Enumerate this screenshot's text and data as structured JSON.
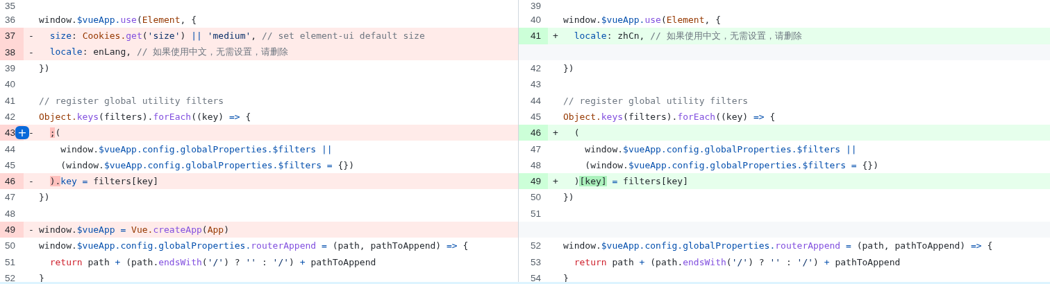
{
  "diff": {
    "left": {
      "lines": [
        {
          "number": "35",
          "kind": "context"
        },
        {
          "number": "36",
          "kind": "context",
          "tokens": [
            {
              "text": "window.",
              "kind": "plain"
            },
            {
              "text": "$vueApp.",
              "kind": "property"
            },
            {
              "text": "use",
              "kind": "function"
            },
            {
              "text": "(",
              "kind": "plain"
            },
            {
              "text": "Element",
              "kind": "class"
            },
            {
              "text": ", {",
              "kind": "plain"
            }
          ]
        },
        {
          "number": "37",
          "kind": "deletion",
          "marker": "-",
          "tokens": [
            {
              "text": "  size",
              "kind": "property"
            },
            {
              "text": ": ",
              "kind": "plain"
            },
            {
              "text": "Cookies.",
              "kind": "class"
            },
            {
              "text": "get",
              "kind": "function"
            },
            {
              "text": "(",
              "kind": "plain"
            },
            {
              "text": "'size'",
              "kind": "string"
            },
            {
              "text": ") ",
              "kind": "plain"
            },
            {
              "text": "|| ",
              "kind": "property"
            },
            {
              "text": "'medium'",
              "kind": "string"
            },
            {
              "text": ", ",
              "kind": "plain"
            },
            {
              "text": "// set element-ui default size",
              "kind": "comment"
            }
          ]
        },
        {
          "number": "38",
          "kind": "deletion",
          "marker": "-",
          "tokens": [
            {
              "text": "  locale",
              "kind": "property"
            },
            {
              "text": ": enLang, ",
              "kind": "plain"
            },
            {
              "text": "// 如果使用中文，无需设置，请删除",
              "kind": "comment"
            }
          ]
        },
        {
          "number": "39",
          "kind": "context",
          "tokens": [
            {
              "text": "})",
              "kind": "plain"
            }
          ]
        },
        {
          "number": "40",
          "kind": "context"
        },
        {
          "number": "41",
          "kind": "context",
          "tokens": [
            {
              "text": "// register global utility filters",
              "kind": "comment"
            }
          ]
        },
        {
          "number": "42",
          "kind": "context",
          "tokens": [
            {
              "text": "Object.",
              "kind": "class"
            },
            {
              "text": "keys",
              "kind": "function"
            },
            {
              "text": "(filters).",
              "kind": "plain"
            },
            {
              "text": "forEach",
              "kind": "function"
            },
            {
              "text": "((key) ",
              "kind": "plain"
            },
            {
              "text": "=>",
              "kind": "property"
            },
            {
              "text": " {",
              "kind": "plain"
            }
          ]
        },
        {
          "number": "43",
          "kind": "deletion",
          "marker": "-",
          "comment_button": "+",
          "tokens": [
            {
              "text": "  ;",
              "kind": "plain",
              "emphasized": true
            },
            {
              "text": "(",
              "kind": "plain"
            }
          ]
        },
        {
          "number": "44",
          "kind": "context",
          "tokens": [
            {
              "text": "    window.",
              "kind": "plain"
            },
            {
              "text": "$vueApp.config.globalProperties.$filters ||",
              "kind": "property"
            }
          ]
        },
        {
          "number": "45",
          "kind": "context",
          "tokens": [
            {
              "text": "    (window.",
              "kind": "plain"
            },
            {
              "text": "$vueApp.config.globalProperties.$filters =",
              "kind": "property"
            },
            {
              "text": " {})",
              "kind": "plain"
            }
          ]
        },
        {
          "number": "46",
          "kind": "deletion",
          "marker": "-",
          "tokens": [
            {
              "text": "  ).",
              "kind": "plain",
              "emphasized": true
            },
            {
              "text": "key =",
              "kind": "property"
            },
            {
              "text": " filters[key]",
              "kind": "plain"
            }
          ]
        },
        {
          "number": "47",
          "kind": "context",
          "tokens": [
            {
              "text": "})",
              "kind": "plain"
            }
          ]
        },
        {
          "number": "48",
          "kind": "context"
        },
        {
          "number": "49",
          "kind": "deletion",
          "marker": "-",
          "tokens": [
            {
              "text": "window.",
              "kind": "plain"
            },
            {
              "text": "$vueApp =",
              "kind": "property"
            },
            {
              "text": " Vue.",
              "kind": "class"
            },
            {
              "text": "createApp",
              "kind": "function"
            },
            {
              "text": "(",
              "kind": "plain"
            },
            {
              "text": "App",
              "kind": "class"
            },
            {
              "text": ")",
              "kind": "plain"
            }
          ]
        },
        {
          "number": "50",
          "kind": "context",
          "tokens": [
            {
              "text": "window.",
              "kind": "plain"
            },
            {
              "text": "$vueApp.config.globalProperties.",
              "kind": "property"
            },
            {
              "text": "routerAppend",
              "kind": "function"
            },
            {
              "text": " =",
              "kind": "property"
            },
            {
              "text": " (path, pathToAppend) ",
              "kind": "plain"
            },
            {
              "text": "=>",
              "kind": "property"
            },
            {
              "text": " {",
              "kind": "plain"
            }
          ]
        },
        {
          "number": "51",
          "kind": "context",
          "tokens": [
            {
              "text": "  return",
              "kind": "keyword"
            },
            {
              "text": " path ",
              "kind": "plain"
            },
            {
              "text": "+",
              "kind": "property"
            },
            {
              "text": " (path.",
              "kind": "plain"
            },
            {
              "text": "endsWith",
              "kind": "function"
            },
            {
              "text": "(",
              "kind": "plain"
            },
            {
              "text": "'/'",
              "kind": "string"
            },
            {
              "text": ") ? ",
              "kind": "plain"
            },
            {
              "text": "''",
              "kind": "string"
            },
            {
              "text": " : ",
              "kind": "plain"
            },
            {
              "text": "'/'",
              "kind": "string"
            },
            {
              "text": ") ",
              "kind": "plain"
            },
            {
              "text": "+",
              "kind": "property"
            },
            {
              "text": " pathToAppend",
              "kind": "plain"
            }
          ]
        },
        {
          "number": "52",
          "kind": "context",
          "tokens": [
            {
              "text": "}",
              "kind": "plain"
            }
          ]
        }
      ]
    },
    "right": {
      "lines": [
        {
          "number": "39",
          "kind": "context"
        },
        {
          "number": "40",
          "kind": "context",
          "tokens": [
            {
              "text": "window.",
              "kind": "plain"
            },
            {
              "text": "$vueApp.",
              "kind": "property"
            },
            {
              "text": "use",
              "kind": "function"
            },
            {
              "text": "(",
              "kind": "plain"
            },
            {
              "text": "Element",
              "kind": "class"
            },
            {
              "text": ", {",
              "kind": "plain"
            }
          ]
        },
        {
          "number": "41",
          "kind": "addition",
          "marker": "+",
          "tokens": [
            {
              "text": "  locale",
              "kind": "property"
            },
            {
              "text": ": zhCn, ",
              "kind": "plain"
            },
            {
              "text": "// 如果使用中文，无需设置，请删除",
              "kind": "comment"
            }
          ]
        },
        {
          "kind": "empty"
        },
        {
          "number": "42",
          "kind": "context",
          "tokens": [
            {
              "text": "})",
              "kind": "plain"
            }
          ]
        },
        {
          "number": "43",
          "kind": "context"
        },
        {
          "number": "44",
          "kind": "context",
          "tokens": [
            {
              "text": "// register global utility filters",
              "kind": "comment"
            }
          ]
        },
        {
          "number": "45",
          "kind": "context",
          "tokens": [
            {
              "text": "Object.",
              "kind": "class"
            },
            {
              "text": "keys",
              "kind": "function"
            },
            {
              "text": "(filters).",
              "kind": "plain"
            },
            {
              "text": "forEach",
              "kind": "function"
            },
            {
              "text": "((key) ",
              "kind": "plain"
            },
            {
              "text": "=>",
              "kind": "property"
            },
            {
              "text": " {",
              "kind": "plain"
            }
          ]
        },
        {
          "number": "46",
          "kind": "addition",
          "marker": "+",
          "tokens": [
            {
              "text": "  (",
              "kind": "plain"
            }
          ]
        },
        {
          "number": "47",
          "kind": "context",
          "tokens": [
            {
              "text": "    window.",
              "kind": "plain"
            },
            {
              "text": "$vueApp.config.globalProperties.$filters ||",
              "kind": "property"
            }
          ]
        },
        {
          "number": "48",
          "kind": "context",
          "tokens": [
            {
              "text": "    (window.",
              "kind": "plain"
            },
            {
              "text": "$vueApp.config.globalProperties.$filters =",
              "kind": "property"
            },
            {
              "text": " {})",
              "kind": "plain"
            }
          ]
        },
        {
          "number": "49",
          "kind": "addition",
          "marker": "+",
          "tokens": [
            {
              "text": "  )",
              "kind": "plain"
            },
            {
              "text": "[key]",
              "kind": "plain",
              "emphasized": true
            },
            {
              "text": " =",
              "kind": "property"
            },
            {
              "text": " filters[key]",
              "kind": "plain"
            }
          ]
        },
        {
          "number": "50",
          "kind": "context",
          "tokens": [
            {
              "text": "})",
              "kind": "plain"
            }
          ]
        },
        {
          "number": "51",
          "kind": "context"
        },
        {
          "kind": "empty"
        },
        {
          "number": "52",
          "kind": "context",
          "tokens": [
            {
              "text": "window.",
              "kind": "plain"
            },
            {
              "text": "$vueApp.config.globalProperties.",
              "kind": "property"
            },
            {
              "text": "routerAppend",
              "kind": "function"
            },
            {
              "text": " =",
              "kind": "property"
            },
            {
              "text": " (path, pathToAppend) ",
              "kind": "plain"
            },
            {
              "text": "=>",
              "kind": "property"
            },
            {
              "text": " {",
              "kind": "plain"
            }
          ]
        },
        {
          "number": "53",
          "kind": "context",
          "tokens": [
            {
              "text": "  return",
              "kind": "keyword"
            },
            {
              "text": " path ",
              "kind": "plain"
            },
            {
              "text": "+",
              "kind": "property"
            },
            {
              "text": " (path.",
              "kind": "plain"
            },
            {
              "text": "endsWith",
              "kind": "function"
            },
            {
              "text": "(",
              "kind": "plain"
            },
            {
              "text": "'/'",
              "kind": "string"
            },
            {
              "text": ") ? ",
              "kind": "plain"
            },
            {
              "text": "''",
              "kind": "string"
            },
            {
              "text": " : ",
              "kind": "plain"
            },
            {
              "text": "'/'",
              "kind": "string"
            },
            {
              "text": ") ",
              "kind": "plain"
            },
            {
              "text": "+",
              "kind": "property"
            },
            {
              "text": " pathToAppend",
              "kind": "plain"
            }
          ]
        },
        {
          "number": "54",
          "kind": "context",
          "tokens": [
            {
              "text": "}",
              "kind": "plain"
            }
          ]
        }
      ]
    }
  }
}
